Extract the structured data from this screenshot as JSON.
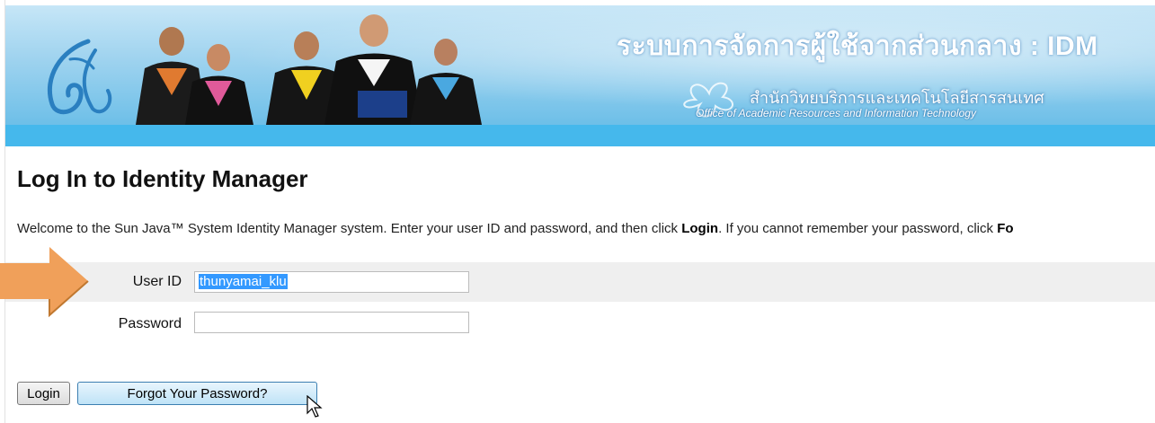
{
  "banner": {
    "title": "ระบบการจัดการผู้ใช้จากส่วนกลาง : IDM",
    "subtitle_th": "สำนักวิทยบริการและเทคโนโลยีสารสนเทศ",
    "subtitle_en": "Office of Academic Resources and Information Technology"
  },
  "page": {
    "title": "Log In to Identity Manager",
    "welcome_pre": "Welcome to the Sun Java™ System Identity Manager system. Enter your user ID and password, and then click ",
    "welcome_login": "Login",
    "welcome_mid": ". If you cannot remember your password, click ",
    "welcome_fo": "Fo"
  },
  "form": {
    "user_label": "User ID",
    "user_value": "thunyamai_klu",
    "password_label": "Password",
    "password_value": ""
  },
  "buttons": {
    "login": "Login",
    "forgot": "Forgot Your Password?"
  },
  "colors": {
    "banner_bar": "#45b8ec",
    "arrow": "#f0a05a"
  }
}
